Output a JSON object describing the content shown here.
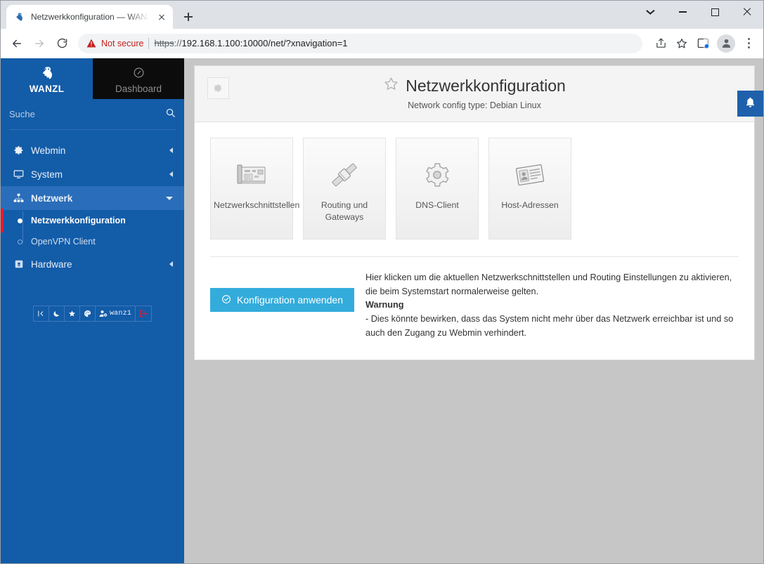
{
  "browser": {
    "tab": {
      "title": "Netzwerkkonfiguration — WANZL",
      "favicon": "webmin-logo-icon"
    },
    "newtab_label": "+",
    "window_controls": {
      "chevron": "chevron-down-icon",
      "minimize": "minimize-icon",
      "maximize": "maximize-icon",
      "close": "close-icon"
    },
    "nav": {
      "back": "back-arrow-icon",
      "forward": "forward-arrow-icon",
      "reload": "reload-icon"
    },
    "omnibox": {
      "security_label": "Not secure",
      "security_icon": "warning-triangle-icon",
      "url_scheme": "https",
      "url_separator": "://",
      "url_rest": "192.168.1.100:10000/net/?xnavigation=1"
    },
    "toolbar_icons": [
      "share-icon",
      "bookmark-star-icon",
      "side-panel-icon",
      "profile-avatar-icon",
      "kebab-menu-icon"
    ]
  },
  "sidebar": {
    "brand": {
      "name": "WANZL",
      "icon": "webmin-logo-icon"
    },
    "dashboard": {
      "label": "Dashboard",
      "icon": "dashboard-gauge-icon"
    },
    "search": {
      "placeholder": "Suche",
      "value": "",
      "icon": "search-icon"
    },
    "nav": [
      {
        "label": "Webmin",
        "icon": "gear-icon",
        "caret": "caret-left",
        "active": false
      },
      {
        "label": "System",
        "icon": "monitor-icon",
        "caret": "caret-left",
        "active": false
      },
      {
        "label": "Netzwerk",
        "icon": "sitemap-icon",
        "caret": "caret-down",
        "active": true
      }
    ],
    "subnav": [
      {
        "label": "Netzwerkkonfiguration",
        "active": true
      },
      {
        "label": "OpenVPN Client",
        "active": false
      }
    ],
    "nav_after": [
      {
        "label": "Hardware",
        "icon": "hardware-chip-icon",
        "caret": "caret-left",
        "active": false
      }
    ],
    "tools": [
      {
        "name": "collapse-sidebar-icon",
        "label": ""
      },
      {
        "name": "dark-mode-moon-icon",
        "label": ""
      },
      {
        "name": "favorites-star-icon",
        "label": ""
      },
      {
        "name": "theme-palette-icon",
        "label": ""
      },
      {
        "name": "user-account-icon",
        "label": "wanz1"
      },
      {
        "name": "logout-icon",
        "label": ""
      }
    ]
  },
  "page": {
    "gear_button": "gear-icon",
    "favorite_icon": "star-outline-icon",
    "title": "Netzwerkkonfiguration",
    "subtitle": "Network config type: Debian Linux",
    "notification_bell": "bell-icon",
    "cards": [
      {
        "label": "Netzwerkschnittstellen",
        "icon": "network-interface-card-icon"
      },
      {
        "label": "Routing und Gateways",
        "icon": "cable-connector-icon"
      },
      {
        "label": "DNS-Client",
        "icon": "gear-icon"
      },
      {
        "label": "Host-Adressen",
        "icon": "address-card-icon"
      }
    ],
    "apply": {
      "button_label": "Konfiguration anwenden",
      "button_icon": "check-circle-icon",
      "line1": "Hier klicken um die aktuellen Netzwerkschnittstellen und Routing Einstellungen zu aktivieren, die beim Systemstart normalerweise gelten.",
      "warning_title": "Warnung",
      "line2": "- Dies könnte bewirken, dass das System nicht mehr über das Netzwerk erreichbar ist und so auch den Zugang zu Webmin verhindert."
    }
  },
  "colors": {
    "sidebar_blue": "#135ca8",
    "sidebar_active": "#2a6dba",
    "accent_button": "#33acdc",
    "bell_blue": "#1e60ab",
    "red_marker": "#e8192c"
  }
}
